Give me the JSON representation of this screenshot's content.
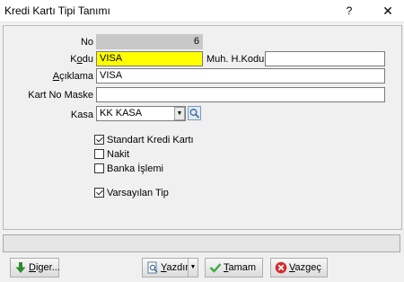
{
  "window": {
    "title": "Kredi Kartı Tipi Tanımı",
    "help_glyph": "?",
    "close_glyph": "✕"
  },
  "form": {
    "no": {
      "label": "No",
      "value": "6"
    },
    "kodu": {
      "label_pre": "K",
      "label_ul": "o",
      "label_post": "du",
      "value": "VISA"
    },
    "muh_kodu": {
      "label": "Muh. H.Kodu",
      "value": ""
    },
    "aciklama": {
      "label_pre": "",
      "label_ul": "A",
      "label_post": "çıklama",
      "value": "VISA"
    },
    "kart_no_maske": {
      "label": "Kart No Maske",
      "value": ""
    },
    "kasa": {
      "label": "Kasa",
      "value": "KK KASA"
    }
  },
  "options": {
    "standart": {
      "label": "Standart Kredi Kartı",
      "checked": true
    },
    "nakit": {
      "label": "Nakit",
      "checked": false
    },
    "banka": {
      "label": "Banka İşlemi",
      "checked": false
    },
    "varsayilan": {
      "label": "Varsayılan Tip",
      "checked": true
    }
  },
  "footer": {
    "diger": {
      "ul": "D",
      "rest": "iger..."
    },
    "yazdir": {
      "ul": "Y",
      "rest": "azdır"
    },
    "tamam": {
      "ul": "T",
      "rest": "amam"
    },
    "vazgec": {
      "ul": "V",
      "rest": "azgeç"
    }
  },
  "colors": {
    "required_field": "#ffff00",
    "readonly_field": "#c8c8c8"
  }
}
